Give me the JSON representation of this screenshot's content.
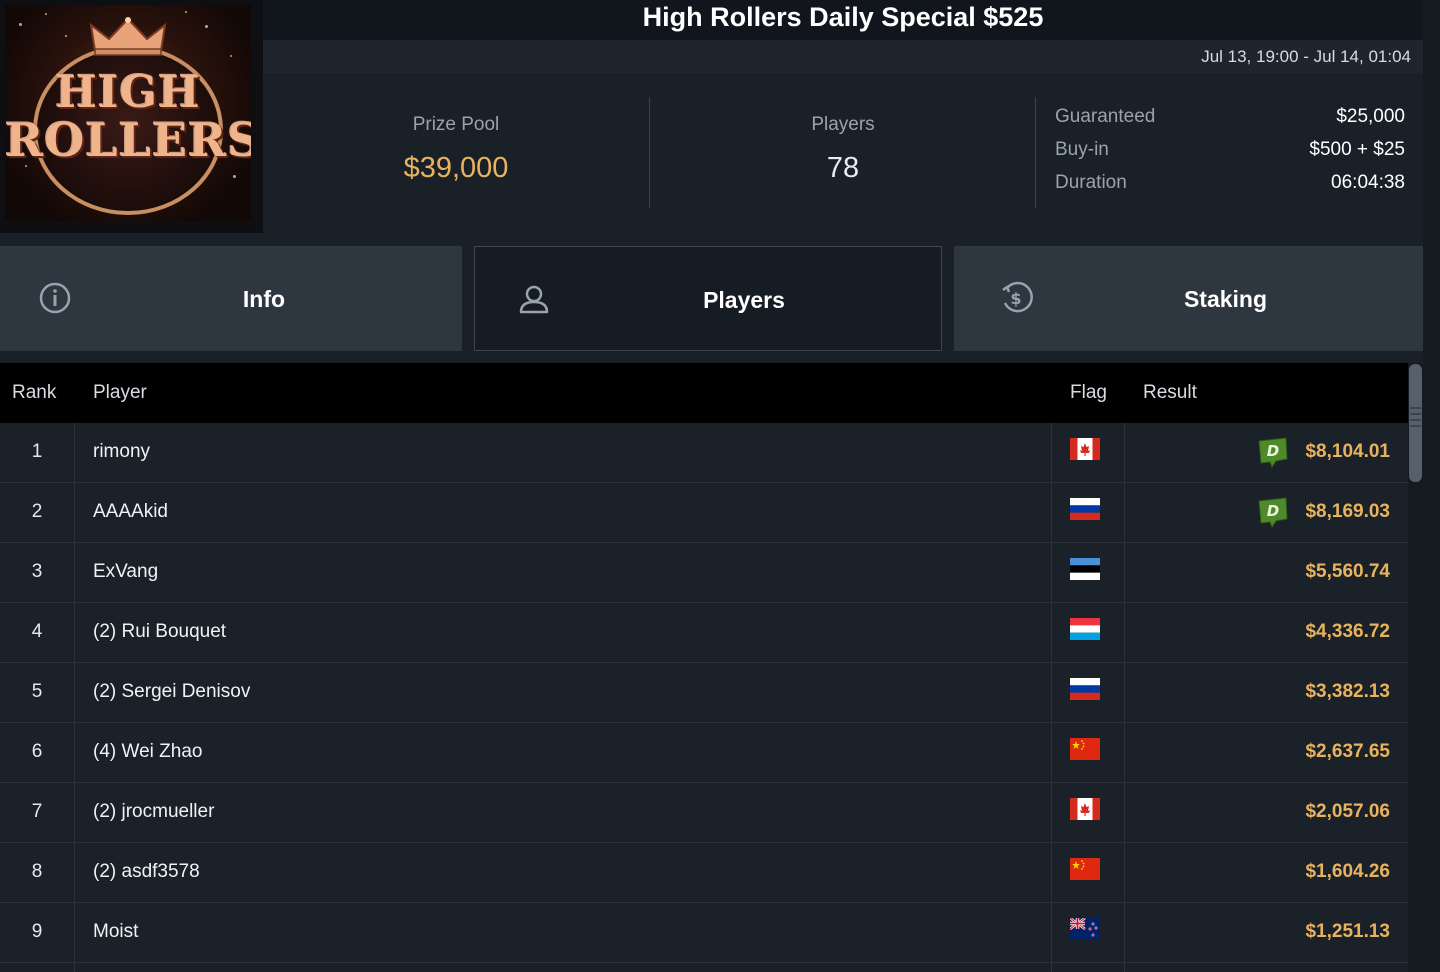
{
  "tournament": {
    "title": "High Rollers Daily Special $525",
    "date_range": "Jul 13, 19:00 - Jul 14, 01:04",
    "logo_text_line1": "HIGH",
    "logo_text_line2": "ROLLERS"
  },
  "stats": {
    "prize_pool_label": "Prize Pool",
    "prize_pool_value": "$39,000",
    "players_label": "Players",
    "players_value": "78"
  },
  "details": [
    {
      "key": "Guaranteed",
      "value": "$25,000"
    },
    {
      "key": "Buy-in",
      "value": "$500 + $25"
    },
    {
      "key": "Duration",
      "value": "06:04:38"
    }
  ],
  "tabs": [
    {
      "label": "Info",
      "icon": "info-icon",
      "active": false
    },
    {
      "label": "Players",
      "icon": "user-icon",
      "active": true
    },
    {
      "label": "Staking",
      "icon": "dollar-coin-icon",
      "active": false
    }
  ],
  "table": {
    "headers": {
      "rank": "Rank",
      "player": "Player",
      "flag": "Flag",
      "result": "Result"
    },
    "rows": [
      {
        "rank": "1",
        "player": "rimony",
        "flag": "canada",
        "result": "$8,104.01",
        "badge": true
      },
      {
        "rank": "2",
        "player": "AAAAkid",
        "flag": "russia",
        "result": "$8,169.03",
        "badge": true
      },
      {
        "rank": "3",
        "player": "ExVang",
        "flag": "estonia",
        "result": "$5,560.74",
        "badge": false
      },
      {
        "rank": "4",
        "player": "(2) Rui Bouquet",
        "flag": "luxembourg",
        "result": "$4,336.72",
        "badge": false
      },
      {
        "rank": "5",
        "player": "(2) Sergei Denisov",
        "flag": "russia",
        "result": "$3,382.13",
        "badge": false
      },
      {
        "rank": "6",
        "player": "(4) Wei Zhao",
        "flag": "china",
        "result": "$2,637.65",
        "badge": false
      },
      {
        "rank": "7",
        "player": "(2) jrocmueller",
        "flag": "canada",
        "result": "$2,057.06",
        "badge": false
      },
      {
        "rank": "8",
        "player": "(2) asdf3578",
        "flag": "china",
        "result": "$1,604.26",
        "badge": false
      },
      {
        "rank": "9",
        "player": "Moist",
        "flag": "new-zealand",
        "result": "$1,251.13",
        "badge": false
      }
    ],
    "badge_letter": "D"
  },
  "colors": {
    "accent_gold": "#e9b35e",
    "badge_green": "#4f8a2a"
  }
}
